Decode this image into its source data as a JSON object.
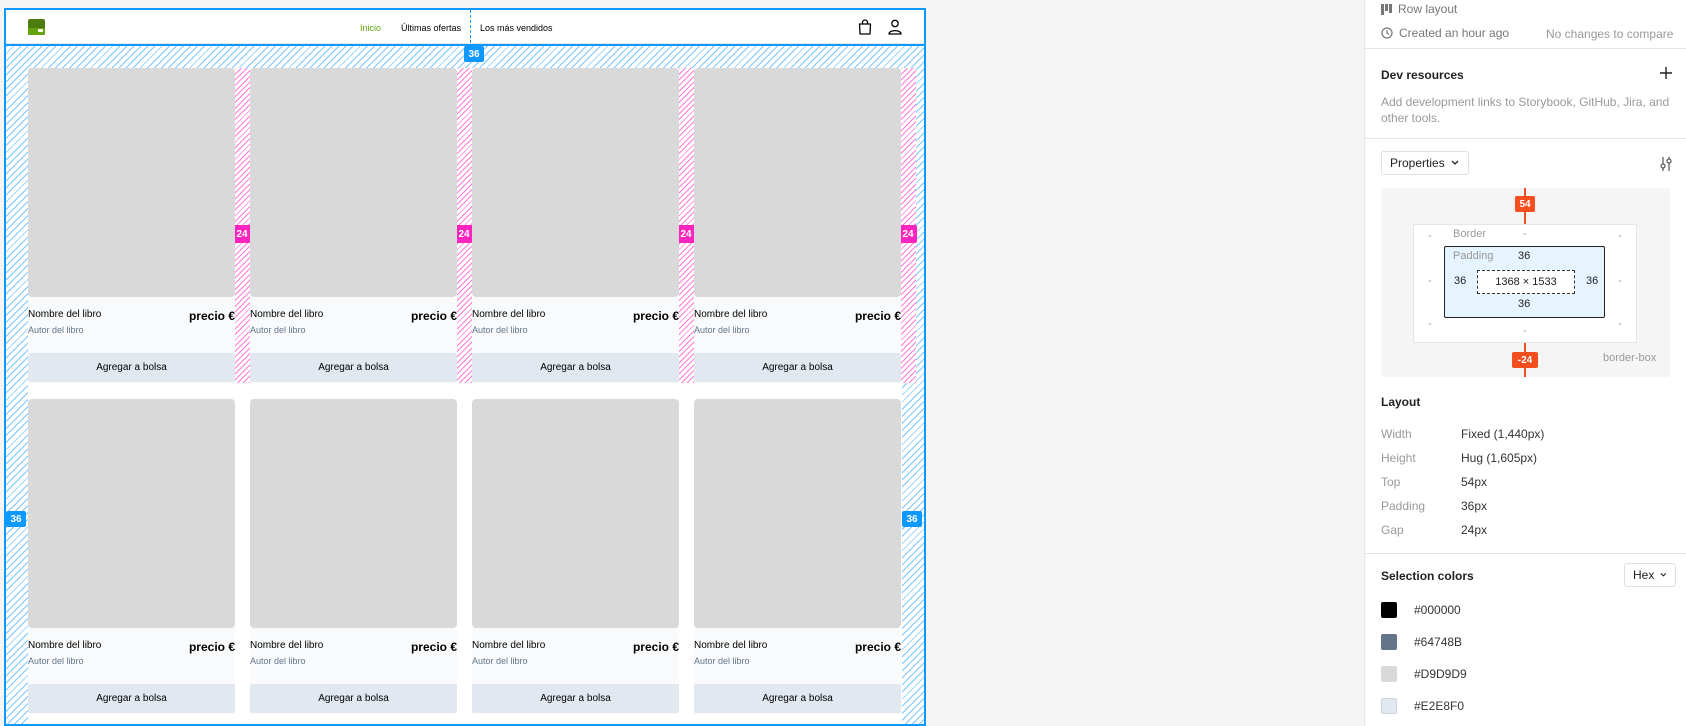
{
  "nav": {
    "links": [
      "Inicio",
      "Últimas ofertas",
      "Los más vendidos"
    ]
  },
  "products": [
    {
      "name": "Nombre del libro",
      "price": "precio €",
      "author": "Autor del libro",
      "button": "Agregar a bolsa"
    },
    {
      "name": "Nombre del libro",
      "price": "precio €",
      "author": "Autor del libro",
      "button": "Agregar a bolsa"
    },
    {
      "name": "Nombre del libro",
      "price": "precio €",
      "author": "Autor del libro",
      "button": "Agregar a bolsa"
    },
    {
      "name": "Nombre del libro",
      "price": "precio €",
      "author": "Autor del libro",
      "button": "Agregar a bolsa"
    },
    {
      "name": "Nombre del libro",
      "price": "precio €",
      "author": "Autor del libro",
      "button": "Agregar a bolsa"
    },
    {
      "name": "Nombre del libro",
      "price": "precio €",
      "author": "Autor del libro",
      "button": "Agregar a bolsa"
    },
    {
      "name": "Nombre del libro",
      "price": "precio €",
      "author": "Autor del libro",
      "button": "Agregar a bolsa"
    },
    {
      "name": "Nombre del libro",
      "price": "precio €",
      "author": "Autor del libro",
      "button": "Agregar a bolsa"
    }
  ],
  "overlay": {
    "gap_badge": "24",
    "padding_badge": "36"
  },
  "panel": {
    "row_layout": "Row layout",
    "created": "Created an hour ago",
    "compare": "No changes to compare",
    "dev_resources": {
      "title": "Dev resources",
      "description_line1": "Add development links to Storybook, GitHub, Jira, and",
      "description_line2": "other tools."
    },
    "properties_label": "Properties",
    "box_model": {
      "margin_top": "54",
      "margin_bottom": "-24",
      "border_label": "Border",
      "padding_label": "Padding",
      "padding_top": "36",
      "padding_left": "36",
      "padding_right": "36",
      "padding_bottom": "36",
      "content_size": "1368 × 1533",
      "dash": "-",
      "sizing": "border-box"
    },
    "layout": {
      "title": "Layout",
      "rows": [
        {
          "key": "Width",
          "value": "Fixed (1,440px)"
        },
        {
          "key": "Height",
          "value": "Hug (1,605px)"
        },
        {
          "key": "Top",
          "value": "54px"
        },
        {
          "key": "Padding",
          "value": "36px"
        },
        {
          "key": "Gap",
          "value": "24px"
        }
      ]
    },
    "selection_colors": {
      "title": "Selection colors",
      "format": "Hex",
      "colors": [
        "#000000",
        "#64748B",
        "#D9D9D9",
        "#E2E8F0"
      ]
    }
  }
}
